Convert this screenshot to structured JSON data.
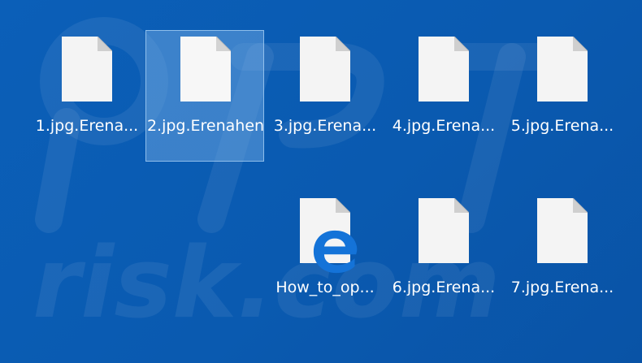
{
  "desktop": {
    "background_color": "#0a5ab0",
    "selection_color": "#78afe6",
    "icons": [
      {
        "label": "1.jpg.Erena...",
        "icon": "blank-file-icon"
      },
      {
        "label": "2.jpg.Erenahen",
        "icon": "blank-file-icon",
        "selected": true
      },
      {
        "label": "3.jpg.Erena...",
        "icon": "blank-file-icon"
      },
      {
        "label": "4.jpg.Erena...",
        "icon": "blank-file-icon"
      },
      {
        "label": "5.jpg.Erena...",
        "icon": "blank-file-icon"
      },
      {
        "label": "How_to_op...",
        "icon": "edge-html-file-icon"
      },
      {
        "label": "6.jpg.Erena...",
        "icon": "blank-file-icon"
      },
      {
        "label": "7.jpg.Erena...",
        "icon": "blank-file-icon"
      }
    ]
  }
}
